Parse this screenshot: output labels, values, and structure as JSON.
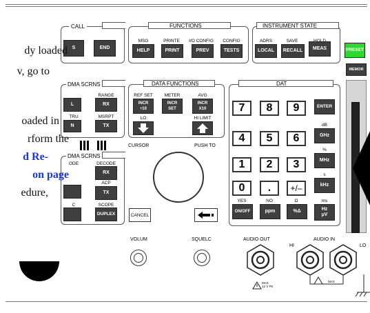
{
  "overlay_text": {
    "line1": "dy loaded",
    "line2": "v, go to",
    "line3": "oaded in",
    "line4": "rform the",
    "link1": "d Re-",
    "link2": "on page",
    "line5": "edure,"
  },
  "call": {
    "title": "CALL",
    "keys": [
      "S",
      "END"
    ]
  },
  "functions": {
    "title": "FUNCTIONS",
    "labels": [
      "MSG",
      "PRINTE",
      "I/O CONFIG",
      "CONFIG"
    ],
    "keys": [
      "HELP",
      "PRINT",
      "PREV",
      "TESTS"
    ]
  },
  "instrument_state": {
    "title": "INSTRUMENT STATE",
    "labels": [
      "ADRS",
      "SAVE",
      "HOLD"
    ],
    "keys": [
      "LOCAL",
      "RECALL",
      "MEAS"
    ]
  },
  "side": {
    "preset": "PRESET",
    "memory": "MEMOR"
  },
  "cdma_scrns": {
    "title": "DMA SCRNS",
    "labels": [
      "RANGE",
      "TRU",
      "MSRPT"
    ],
    "keys": [
      "L",
      "RX",
      "N",
      "TX"
    ]
  },
  "data_functions": {
    "title": "DATA FUNCTIONS",
    "labels": [
      "REF SET",
      "METER",
      "AVG",
      "LO",
      "HI LIMIT"
    ],
    "keys": [
      "INCR\n÷10",
      "INCR\nSET",
      "INCR\nX10"
    ]
  },
  "amps_scrns": {
    "title": "DMA SCRNS",
    "labels": [
      "ODE",
      "DECODE",
      "ACP",
      "C",
      "SCOPE"
    ],
    "keys": [
      "RX",
      "TX",
      "DUPLEX"
    ]
  },
  "knob": {
    "cursor": "CURSOR",
    "push_to": "PUSH TO"
  },
  "cancel": "CANCEL",
  "data": {
    "title": "DAT",
    "digits": [
      "7",
      "8",
      "9",
      "4",
      "5",
      "6",
      "1",
      "2",
      "3",
      "0",
      ".",
      "+/–"
    ],
    "enter": "ENTER",
    "unit_labels": [
      "dB",
      "%",
      "s",
      "ms"
    ],
    "unit_keys": [
      "GHz",
      "MHz",
      "kHz",
      "Hz\nμV"
    ],
    "bottom_labels": [
      "YES",
      "NO",
      "Ω"
    ],
    "bottom_keys": [
      "ON/OFF",
      "ppm",
      "%Δ"
    ]
  },
  "bottom": {
    "volume": "VOLUM",
    "squelch": "SQUELC",
    "audio_out": "AUDIO OUT",
    "audio_in": "AUDIO IN",
    "hi": "HI",
    "lo": "LO",
    "max1": "MAX\n12 V PK",
    "max2": "MAX"
  }
}
